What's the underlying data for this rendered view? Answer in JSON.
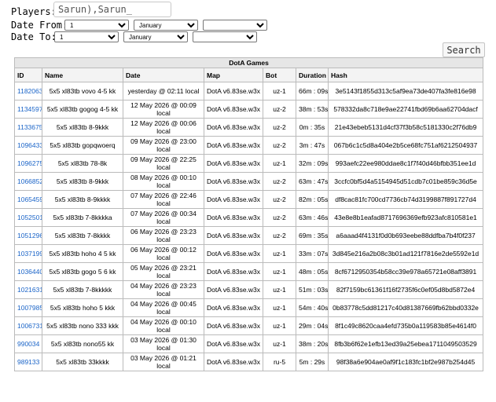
{
  "filters": {
    "players_label": "Players:",
    "players_value": "Sarun),Sarun_",
    "date_from_label": "Date From:",
    "date_to_label": "Date To:",
    "from_day": "1",
    "from_month": "January",
    "from_year": "",
    "to_day": "1",
    "to_month": "January",
    "to_year": "",
    "search_label": "Search"
  },
  "table": {
    "caption": "DotA Games",
    "columns": [
      "ID",
      "Name",
      "Date",
      "Map",
      "Bot",
      "Duration",
      "Hash"
    ],
    "rows": [
      {
        "id": "1182063",
        "name": "5x5 xl83tb vovo 4-5 kk",
        "date": "yesterday @ 02:11 local",
        "map": "DotA v6.83se.w3x",
        "bot": "uz-1",
        "duration": "66m : 09s",
        "hash": "3e5143f1855d313c5af9ea73de407fa3fe816e98"
      },
      {
        "id": "1134597",
        "name": "5x5 xl83tb gogog 4-5 kk",
        "date": "12 May 2026 @ 00:09 local",
        "map": "DotA v6.83se.w3x",
        "bot": "uz-2",
        "duration": "38m : 53s",
        "hash": "578332da8c718e9ae22741fbd69b6aa62704dacf"
      },
      {
        "id": "1133675",
        "name": "5x5 xl83tb 8-9kkk",
        "date": "12 May 2026 @ 00:06 local",
        "map": "DotA v6.83se.w3x",
        "bot": "uz-2",
        "duration": "0m : 35s",
        "hash": "21e43ebeb5131d4cf37f3b58c5181330c2f76db9"
      },
      {
        "id": "1096433",
        "name": "5x5 xl83tb gopqwoerq",
        "date": "09 May 2026 @ 23:00 local",
        "map": "DotA v6.83se.w3x",
        "bot": "uz-2",
        "duration": "3m : 47s",
        "hash": "067b6c1c5d8a404e2b5ce68fc751af6212504937"
      },
      {
        "id": "1096275",
        "name": "5x5 xl83tb 78-8k",
        "date": "09 May 2026 @ 22:25 local",
        "map": "DotA v6.83se.w3x",
        "bot": "uz-1",
        "duration": "32m : 09s",
        "hash": "993aefc22ee980ddae8c1f7f40d46bfbb351ee1d"
      },
      {
        "id": "1066852",
        "name": "5x5 xl83tb 8-9kkk",
        "date": "08 May 2026 @ 00:10 local",
        "map": "DotA v6.83se.w3x",
        "bot": "uz-2",
        "duration": "63m : 47s",
        "hash": "3ccfc0bf5d4a5154945d51cdb7c01be859c36d5e"
      },
      {
        "id": "1065459",
        "name": "5x5 xl83tb 8-9kkkk",
        "date": "07 May 2026 @ 22:46 local",
        "map": "DotA v6.83se.w3x",
        "bot": "uz-2",
        "duration": "82m : 05s",
        "hash": "df8cac81fc700cd7736cb74d3199887f891727d4"
      },
      {
        "id": "1052501",
        "name": "5x5 xl83tb 7-8kkkka",
        "date": "07 May 2026 @ 00:34 local",
        "map": "DotA v6.83se.w3x",
        "bot": "uz-2",
        "duration": "63m : 46s",
        "hash": "43e8e8b1eafad8717696369efb923afc810581e1"
      },
      {
        "id": "1051296",
        "name": "5x5 xl83tb 7-8kkkk",
        "date": "06 May 2026 @ 23:23 local",
        "map": "DotA v6.83se.w3x",
        "bot": "uz-2",
        "duration": "69m : 35s",
        "hash": "a6aaad4f4131f0d0b693eebe88ddfba7b4f0f237"
      },
      {
        "id": "1037199",
        "name": "5x5 xl83tb hoho 4 5 kk",
        "date": "06 May 2026 @ 00:12 local",
        "map": "DotA v6.83se.w3x",
        "bot": "uz-1",
        "duration": "33m : 07s",
        "hash": "3d845e216a2b08c3b01ad121f7816e2de5592e1d"
      },
      {
        "id": "1036440",
        "name": "5x5 xl83tb gogo 5 6 kk",
        "date": "05 May 2026 @ 23:21 local",
        "map": "DotA v6.83se.w3x",
        "bot": "uz-1",
        "duration": "48m : 05s",
        "hash": "8cf6712950354b58cc39e978a65721e08aff3891"
      },
      {
        "id": "1021631",
        "name": "5x5 xl83tb 7-8kkkkk",
        "date": "04 May 2026 @ 23:23 local",
        "map": "DotA v6.83se.w3x",
        "bot": "uz-1",
        "duration": "51m : 03s",
        "hash": "82f7159bc61361f16f2735f6c0ef05d8bd5872e4"
      },
      {
        "id": "1007985",
        "name": "5x5 xl83tb hoho 5 kkk",
        "date": "04 May 2026 @ 00:45 local",
        "map": "DotA v6.83se.w3x",
        "bot": "uz-1",
        "duration": "54m : 40s",
        "hash": "0b83778c5dd81217c40d81387669fb62bbd0332e"
      },
      {
        "id": "1006731",
        "name": "5x5 xl83tb nono 333 kkk",
        "date": "04 May 2026 @ 00:10 local",
        "map": "DotA v6.83se.w3x",
        "bot": "uz-1",
        "duration": "29m : 04s",
        "hash": "8f1c49c8620caa4efd735b0a119583b85e4614f0"
      },
      {
        "id": "990034",
        "name": "5x5 xl83tb nono55 kk",
        "date": "03 May 2026 @ 01:30 local",
        "map": "DotA v6.83se.w3x",
        "bot": "uz-1",
        "duration": "38m : 20s",
        "hash": "8fb3b6f62e1efb13ed39a25ebea1711049503529"
      },
      {
        "id": "989133",
        "name": "5x5 xl83tb 33kkkk",
        "date": "03 May 2026 @ 01:21 local",
        "map": "DotA v6.83se.w3x",
        "bot": "ru-5",
        "duration": "5m : 29s",
        "hash": "98f38a6e904ae0af9f1c183fc1bf2e987b254d45"
      }
    ]
  }
}
